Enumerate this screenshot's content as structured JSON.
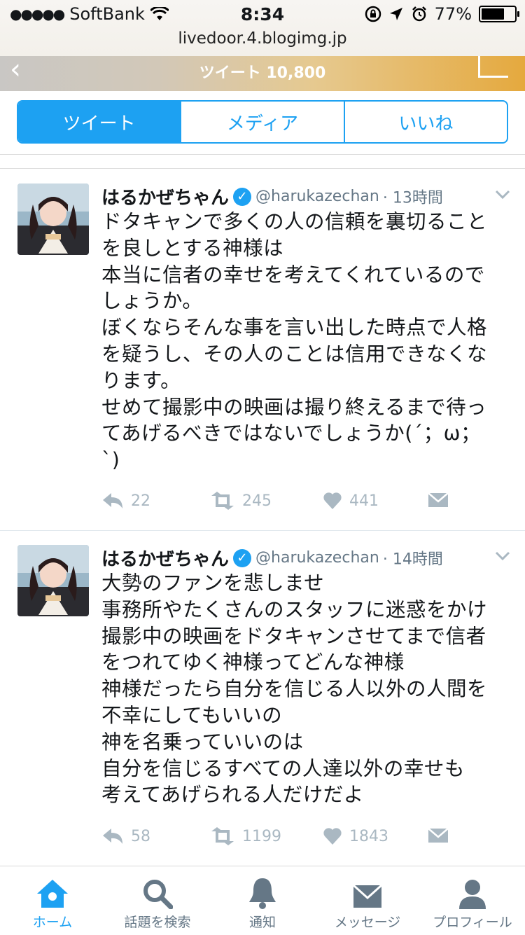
{
  "status_bar": {
    "carrier": "SoftBank",
    "time": "8:34",
    "battery_pct": "77%",
    "battery_level": 0.77,
    "url": "livedoor.4.blogimg.jp"
  },
  "header": {
    "tweet_count": "ツイート 10,800"
  },
  "tabs": [
    {
      "label": "ツイート",
      "active": true
    },
    {
      "label": "メディア",
      "active": false
    },
    {
      "label": "いいね",
      "active": false
    }
  ],
  "tweets": [
    {
      "name": "はるかぜちゃん",
      "handle": "@harukazechan",
      "time": "· 13時間",
      "text": "ドタキャンで多くの人の信頼を裏切ること\nを良しとする神様は\n本当に信者の幸せを考えてくれているので\nしょうか。\nぼくならそんな事を言い出した時点で人格\nを疑うし、その人のことは信用できなくな\nります。\nせめて撮影中の映画は撮り終えるまで待っ\nてあげるべきではないでしょうか(´；ω；\n`)",
      "replies": "22",
      "retweets": "245",
      "likes": "441"
    },
    {
      "name": "はるかぜちゃん",
      "handle": "@harukazechan",
      "time": "· 14時間",
      "text": "大勢のファンを悲しませ\n事務所やたくさんのスタッフに迷惑をかけ\n撮影中の映画をドタキャンさせてまで信者\nをつれてゆく神様ってどんな神様\n神様だったら自分を信じる人以外の人間を\n不幸にしてもいいの\n神を名乗っていいのは\n自分を信じるすべての人達以外の幸せも\n考えてあげられる人だけだよ",
      "replies": "58",
      "retweets": "1199",
      "likes": "1843"
    }
  ],
  "tab_bar": [
    {
      "label": "ホーム",
      "icon": "home-icon",
      "active": true
    },
    {
      "label": "話題を検索",
      "icon": "search-icon",
      "active": false
    },
    {
      "label": "通知",
      "icon": "bell-icon",
      "active": false
    },
    {
      "label": "メッセージ",
      "icon": "envelope-icon",
      "active": false
    },
    {
      "label": "プロフィール",
      "icon": "person-icon",
      "active": false
    }
  ],
  "colors": {
    "accent": "#1da1f2",
    "muted": "#aab8c2",
    "text": "#14171a"
  }
}
